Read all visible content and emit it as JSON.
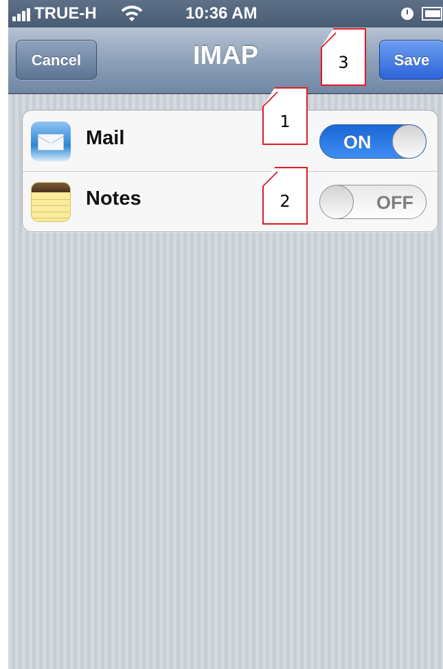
{
  "status_bar": {
    "carrier": "TRUE-H",
    "time": "10:36 AM",
    "icons": [
      "signal-icon",
      "wifi-icon",
      "clock-icon",
      "battery-icon"
    ]
  },
  "nav_bar": {
    "title": "IMAP",
    "cancel_label": "Cancel",
    "save_label": "Save"
  },
  "settings": {
    "rows": [
      {
        "label": "Mail",
        "icon": "mail-icon",
        "toggle_label": "ON",
        "toggle_state": true
      },
      {
        "label": "Notes",
        "icon": "notes-icon",
        "toggle_label": "OFF",
        "toggle_state": false
      }
    ]
  },
  "annotations": {
    "callout_1": "1",
    "callout_2": "2",
    "callout_3": "3"
  },
  "colors": {
    "nav_bar": "#8ea1b9",
    "save_button": "#2d64d8",
    "toggle_on": "#1a67d6",
    "background": "#cbd2d8",
    "callout_border": "#e0191f"
  }
}
